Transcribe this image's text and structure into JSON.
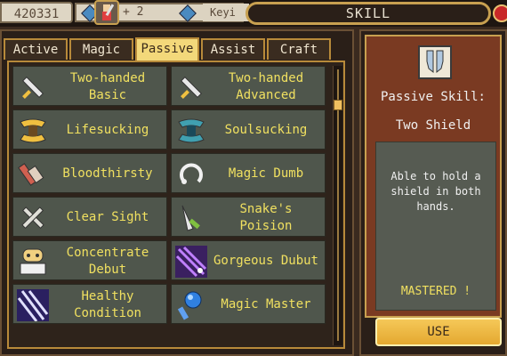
{
  "topbar": {
    "gold": "420331",
    "gem_plus": "+ 2",
    "player_name": "Keyi"
  },
  "window": {
    "title": "SKILL"
  },
  "tabs": [
    {
      "label": "Active",
      "active": false
    },
    {
      "label": "Magic",
      "active": false
    },
    {
      "label": "Passive",
      "active": true
    },
    {
      "label": "Assist",
      "active": false
    },
    {
      "label": "Craft",
      "active": false
    }
  ],
  "skills": [
    {
      "label": "Two-handed\nBasic",
      "icon": "sword-icon",
      "color": "#e8e0c8"
    },
    {
      "label": "Two-handed\nAdvanced",
      "icon": "sword-icon",
      "color": "#e8e0c8"
    },
    {
      "label": "Lifesucking",
      "icon": "fangs-icon",
      "color": "#f0c040"
    },
    {
      "label": "Soulsucking",
      "icon": "fangs-icon",
      "color": "#40a0b0"
    },
    {
      "label": "Bloodthirsty",
      "icon": "crossbow-icon",
      "color": "#d06050"
    },
    {
      "label": "Magic Dumb",
      "icon": "magic-ring-icon",
      "color": "#e8e8e8"
    },
    {
      "label": "Clear Sight",
      "icon": "crossed-bones-icon",
      "color": "#e0e0d8"
    },
    {
      "label": "Snake's\nPoision",
      "icon": "fang-dagger-icon",
      "color": "#80c040"
    },
    {
      "label": "Concentrate\nDebut",
      "icon": "face-scroll-icon",
      "color": "#f0d080"
    },
    {
      "label": "Gorgeous Dubut",
      "icon": "purple-spark-icon",
      "color": "#9040d0"
    },
    {
      "label": "Healthy\nCondition",
      "icon": "claw-slash-icon",
      "color": "#6a50c0"
    },
    {
      "label": "Magic Master",
      "icon": "blue-orb-icon",
      "color": "#3080e0"
    }
  ],
  "detail": {
    "icon": "shield-scroll-icon",
    "type_label": "Passive Skill:",
    "name": "Two Shield",
    "description": "Able to hold a shield in both hands.",
    "status": "MASTERED !",
    "use_label": "USE"
  },
  "colors": {
    "skill_label": "#f0e060",
    "tab_active": "#f3d87a",
    "accent_border": "#b88a3a",
    "detail_bg": "#7a3a22"
  }
}
